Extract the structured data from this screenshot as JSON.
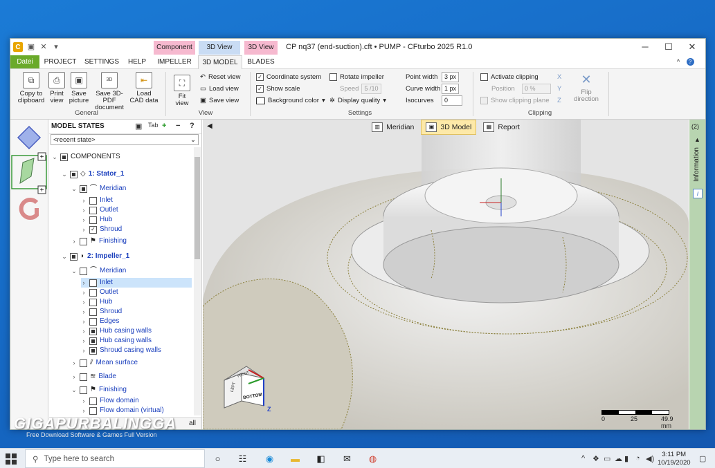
{
  "window": {
    "title": "CP nq37 (end-suction).cft • PUMP - CFturbo 2025 R1.0",
    "context_tabs": [
      {
        "label": "Component",
        "color": "#f6b9cf"
      },
      {
        "label": "3D View",
        "color": "#c9dcf4"
      },
      {
        "label": "3D View",
        "color": "#f6b9cf"
      }
    ]
  },
  "tabs": [
    "Datei",
    "PROJECT",
    "SETTINGS",
    "HELP",
    "IMPELLER",
    "3D MODEL",
    "BLADES"
  ],
  "ribbon": {
    "general": {
      "label": "General",
      "buttons": [
        {
          "icon": "copy-icon",
          "label": "Copy to clipboard"
        },
        {
          "icon": "printer-icon",
          "label": "Print view"
        },
        {
          "icon": "save-icon",
          "label": "Save picture"
        },
        {
          "icon": "pdf-3d-icon",
          "label": "Save 3D-PDF document"
        },
        {
          "icon": "load-cad-icon",
          "label": "Load CAD data"
        }
      ]
    },
    "view": {
      "label": "View",
      "fit": "Fit view",
      "items": [
        "Reset view",
        "Load view",
        "Save view"
      ]
    },
    "settings": {
      "label": "Settings",
      "coordinate_system": "Coordinate system",
      "show_scale": "Show scale",
      "background_color": "Background color",
      "rotate_impeller": "Rotate impeller",
      "speed_label": "Speed",
      "speed_value": "5 /10",
      "display_quality": "Display quality",
      "point_width_label": "Point width",
      "point_width_value": "3 px",
      "curve_width_label": "Curve width",
      "curve_width_value": "1 px",
      "isocurves_label": "Isocurves",
      "isocurves_value": "0"
    },
    "clipping": {
      "label": "Clipping",
      "activate": "Activate clipping",
      "position_label": "Position",
      "position_value": "0 %",
      "show_plane": "Show clipping plane",
      "flip": "Flip direction"
    }
  },
  "tree": {
    "header": "MODEL STATES",
    "combo": "<recent state>",
    "nodes": [
      {
        "label": "COMPONENTS",
        "style": "dark"
      },
      {
        "label": "1: Stator_1",
        "style": "bold"
      },
      {
        "label": "Meridian",
        "style": "normal"
      },
      {
        "label": "Inlet",
        "style": "normal"
      },
      {
        "label": "Outlet",
        "style": "normal"
      },
      {
        "label": "Hub",
        "style": "normal"
      },
      {
        "label": "Shroud",
        "style": "normal"
      },
      {
        "label": "Finishing",
        "style": "normal"
      },
      {
        "label": "2: Impeller_1",
        "style": "bold"
      },
      {
        "label": "Meridian",
        "style": "normal"
      },
      {
        "label": "Inlet",
        "style": "normal"
      },
      {
        "label": "Outlet",
        "style": "normal"
      },
      {
        "label": "Hub",
        "style": "normal"
      },
      {
        "label": "Shroud",
        "style": "normal"
      },
      {
        "label": "Edges",
        "style": "normal"
      },
      {
        "label": "Hub casing walls",
        "style": "normal"
      },
      {
        "label": "Hub casing walls",
        "style": "normal"
      },
      {
        "label": "Shroud casing walls",
        "style": "normal"
      },
      {
        "label": "Mean surface",
        "style": "normal"
      },
      {
        "label": "Blade",
        "style": "normal"
      },
      {
        "label": "Finishing",
        "style": "normal"
      },
      {
        "label": "Flow domain",
        "style": "normal"
      },
      {
        "label": "Flow domain (virtual)",
        "style": "normal"
      }
    ],
    "footer_all": "all"
  },
  "viewport": {
    "tabs": [
      "Meridian",
      "3D Model",
      "Report"
    ],
    "active_tab": "3D Model",
    "cube_faces": [
      "LEFT",
      "BOTTOM",
      "FRONT"
    ],
    "axis_label": "Z",
    "scale": {
      "ticks": [
        "0",
        "25",
        "49.9 mm"
      ]
    }
  },
  "right_panel": {
    "count": "(2)",
    "label": "Information"
  },
  "taskbar": {
    "search_placeholder": "Type here to search",
    "time": "3:11 PM",
    "date": "10/19/2020"
  },
  "watermark": {
    "brand": "GIGAPURBALINGGA",
    "tagline": "Free Download Software & Games Full Version"
  }
}
